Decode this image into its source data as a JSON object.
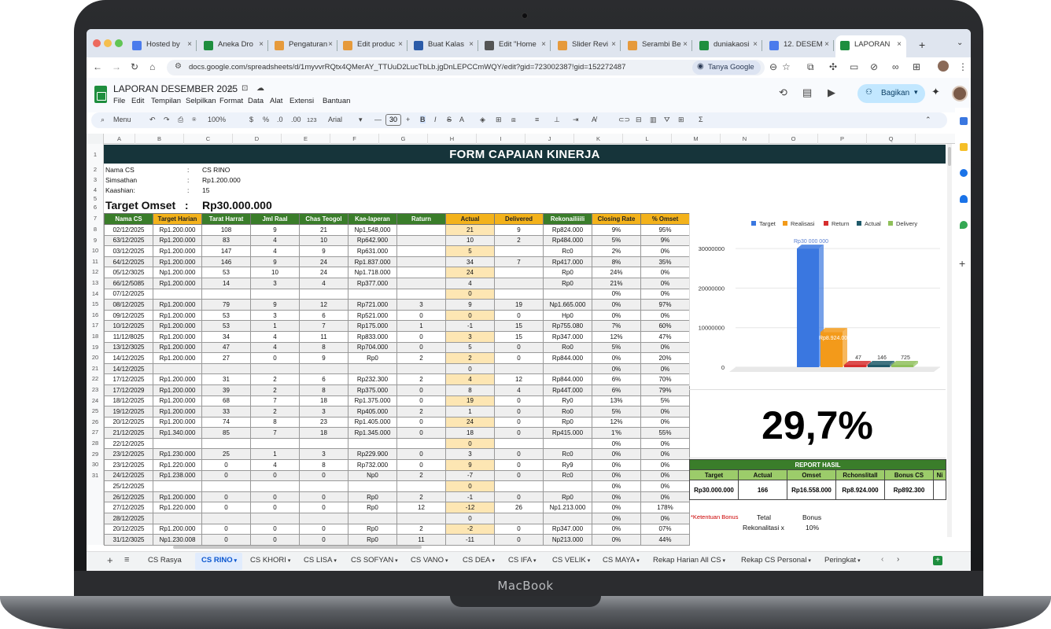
{
  "browser": {
    "tabs": [
      {
        "label": "Hosted by",
        "color": "#4b7bec"
      },
      {
        "label": "Aneka Dro",
        "color": "#1e8e3e"
      },
      {
        "label": "Pengaturan",
        "color": "#e69a3b"
      },
      {
        "label": "Edit produc",
        "color": "#e69a3b"
      },
      {
        "label": "Buat Kalas",
        "color": "#2b5ba8"
      },
      {
        "label": "Edit \"Home",
        "color": "#555"
      },
      {
        "label": "Slider Revi",
        "color": "#e69a3b"
      },
      {
        "label": "Serambi Be",
        "color": "#e69a3b"
      },
      {
        "label": "duniakaosi",
        "color": "#1e8e3e"
      },
      {
        "label": "12. DESEM",
        "color": "#4b7bec"
      },
      {
        "label": "LAPORAN",
        "color": "#1e8e3e"
      }
    ],
    "url": "docs.google.com/spreadsheets/d/1myvvrRQtx4QMerAY_TTUuD2LucTbLb.jgDnLEPCCmWQY/edit?gid=723002387!gid=152272487",
    "tanya": "Tanya Google"
  },
  "sheets": {
    "title": "LAPORAN DESEMBER 2025",
    "menus": [
      "File",
      "Edit",
      "Tempilan",
      "Selpilkan",
      "Format",
      "Data",
      "Alat",
      "Extensi",
      "Bantuan"
    ],
    "share": "Bagikan",
    "toolbar": {
      "menu": "Menu",
      "zoom": "100%",
      "currency": "$",
      "percent": "%",
      "fmt123": "123",
      "font": "Arial",
      "fontsize": "30",
      "minus": "—",
      "plus": "+",
      "bold": "B",
      "italic": "I",
      "strike": "S",
      "sigma": "Σ"
    }
  },
  "columns": [
    "A",
    "B",
    "C",
    "D",
    "E",
    "F",
    "G",
    "H",
    "I",
    "J",
    "K",
    "L",
    "M",
    "N",
    "O",
    "P",
    "Q"
  ],
  "rows": [
    "1",
    "2",
    "3",
    "4",
    "5",
    "6",
    "7",
    "8",
    "9",
    "10",
    "11",
    "12",
    "13",
    "14",
    "15",
    "16",
    "17",
    "18",
    "19",
    "20",
    "21",
    "22",
    "23",
    "24",
    "25",
    "26",
    "27",
    "28",
    "29",
    "30",
    "31"
  ],
  "form": {
    "title": "FORM CAPAIAN KINERJA",
    "info": [
      {
        "label": "Nama CS",
        "sep": ":",
        "value": "CS RINO"
      },
      {
        "label": "Simsathan",
        "sep": ":",
        "value": "Rp1.200.000"
      },
      {
        "label": "Kaashian:",
        "sep": ":",
        "value": "15"
      }
    ],
    "target_label": "Target Omset",
    "target_sep": ":",
    "target_value": "Rp30.000.000"
  },
  "table": {
    "headers": [
      "Nama CS",
      "Target Harian",
      "Tarat Harrat",
      "Jml Raal",
      "Chas Teogol",
      "Kae-laperan",
      "Raturn",
      "Actual",
      "Delivered",
      "Rekonailiiili",
      "Closing Rate",
      "% Omset"
    ],
    "rows": [
      [
        "02/12/2025",
        "Rp1.200.000",
        "108",
        "9",
        "21",
        "Np1,548,000",
        "",
        "21",
        "9",
        "Rp824.000",
        "9%",
        "95%"
      ],
      [
        "63/12/2025",
        "Rp1.200.000",
        "83",
        "4",
        "10",
        "Rp642.900",
        "",
        "10",
        "2",
        "Rp484.000",
        "5%",
        "9%"
      ],
      [
        "03/12/2025",
        "Rp1.200.000",
        "147",
        "4",
        "9",
        "Rp631.000",
        "",
        "5",
        "",
        "Rc0",
        "2%",
        "0%"
      ],
      [
        "64/12/2025",
        "Rp1.200.000",
        "146",
        "9",
        "24",
        "Rp1.837.000",
        "",
        "34",
        "7",
        "Rp417.000",
        "8%",
        "35%"
      ],
      [
        "05/12/3025",
        "Np1.200.000",
        "53",
        "10",
        "24",
        "Np1.718.000",
        "",
        "24",
        "",
        "Rp0",
        "24%",
        "0%"
      ],
      [
        "66/12/5085",
        "Rp1.200.000",
        "14",
        "3",
        "4",
        "Rp377.000",
        "",
        "4",
        "",
        "Rp0",
        "21%",
        "0%"
      ],
      [
        "07/12/2025",
        "",
        "",
        "",
        "",
        "",
        "",
        "0",
        "",
        "",
        "0%",
        "0%"
      ],
      [
        "08/12/2025",
        "Rp1.200.000",
        "79",
        "9",
        "12",
        "Rp721.000",
        "3",
        "9",
        "19",
        "Np1.665.000",
        "0%",
        "97%"
      ],
      [
        "09/12/2025",
        "Rp1.200.000",
        "53",
        "3",
        "6",
        "Rp521.000",
        "0",
        "0",
        "0",
        "Hp0",
        "0%",
        "0%"
      ],
      [
        "10/12/2025",
        "Rp1.200.000",
        "53",
        "1",
        "7",
        "Rp175.000",
        "1",
        "-1",
        "15",
        "Rp755.080",
        "7%",
        "60%"
      ],
      [
        "11/12/8025",
        "Rp1.200.000",
        "34",
        "4",
        "11",
        "Rp833.000",
        "0",
        "3",
        "15",
        "Rp347.000",
        "12%",
        "47%"
      ],
      [
        "13/12/3025",
        "Rp1.200.000",
        "47",
        "4",
        "8",
        "Rp704.000",
        "0",
        "5",
        "0",
        "Ro0",
        "5%",
        "0%"
      ],
      [
        "14/12/2025",
        "Rp1.200.000",
        "27",
        "0",
        "9",
        "Rp0",
        "2",
        "2",
        "0",
        "Rp844.000",
        "0%",
        "20%"
      ],
      [
        "14/12/2025",
        "",
        "",
        "",
        "",
        "",
        "",
        "0",
        "",
        "",
        "0%",
        "0%"
      ],
      [
        "17/12/2025",
        "Rp1.200.000",
        "31",
        "2",
        "6",
        "Rp232.300",
        "2",
        "4",
        "12",
        "Rp844.000",
        "6%",
        "70%"
      ],
      [
        "17/12/2029",
        "Rp1.200.000",
        "39",
        "2",
        "8",
        "Rp375.000",
        "0",
        "8",
        "4",
        "Rp44T.000",
        "6%",
        "79%"
      ],
      [
        "18/12/2025",
        "Rp1.200.000",
        "68",
        "7",
        "18",
        "Rp1.375.000",
        "0",
        "19",
        "0",
        "Ry0",
        "13%",
        "5%"
      ],
      [
        "19/12/2025",
        "Rp1.200.000",
        "33",
        "2",
        "3",
        "Rp405.000",
        "2",
        "1",
        "0",
        "Ro0",
        "5%",
        "0%"
      ],
      [
        "20/12/2025",
        "Rp1.200.000",
        "74",
        "8",
        "23",
        "Rp1.405.000",
        "0",
        "24",
        "0",
        "Rp0",
        "12%",
        "0%"
      ],
      [
        "21/12/2025",
        "Rp1.340.000",
        "85",
        "7",
        "18",
        "Rp1.345.000",
        "0",
        "18",
        "0",
        "Rp415.000",
        "1'%",
        "55%"
      ],
      [
        "22/12/2025",
        "",
        "",
        "",
        "",
        "",
        "",
        "0",
        "",
        "",
        "0%",
        "0%"
      ],
      [
        "23/12/2025",
        "Rp1.230.000",
        "25",
        "1",
        "3",
        "Rp229.900",
        "0",
        "3",
        "0",
        "Rc0",
        "0%",
        "0%"
      ],
      [
        "23/12/2025",
        "Rp1.220.000",
        "0",
        "4",
        "8",
        "Rp732.000",
        "0",
        "9",
        "0",
        "Ry9",
        "0%",
        "0%"
      ],
      [
        "24/12/2025",
        "Rp1.238.000",
        "0",
        "0",
        "0",
        "Np0",
        "2",
        "-7",
        "0",
        "Rc0",
        "0%",
        "0%"
      ],
      [
        "25/12/2025",
        "",
        "",
        "",
        "",
        "",
        "",
        "0",
        "",
        "",
        "0%",
        "0%"
      ],
      [
        "26/12/2025",
        "Rp1.200.000",
        "0",
        "0",
        "0",
        "Rp0",
        "2",
        "-1",
        "0",
        "Rp0",
        "0%",
        "0%"
      ],
      [
        "27/12/2025",
        "Rp1.220.000",
        "0",
        "0",
        "0",
        "Rp0",
        "12",
        "-12",
        "26",
        "Np1.213.000",
        "0%",
        "178%"
      ],
      [
        "28/12/2025",
        "",
        "",
        "",
        "",
        "",
        "",
        "0",
        "",
        "",
        "0%",
        "0%"
      ],
      [
        "20/12/2025",
        "Rp1.200.000",
        "0",
        "0",
        "0",
        "Rp0",
        "2",
        "-2",
        "0",
        "Rp347.000",
        "0%",
        "07%"
      ],
      [
        "31/12/3025",
        "Np1.230.008",
        "0",
        "0",
        "0",
        "Rp0",
        "11",
        "-11",
        "0",
        "Np213.000",
        "0%",
        "44%"
      ]
    ]
  },
  "chart_data": {
    "type": "bar",
    "legend_position": "top",
    "series": [
      {
        "name": "Target",
        "color": "#3a77e0"
      },
      {
        "name": "Realisasi",
        "color": "#f39a1a"
      },
      {
        "name": "Return",
        "color": "#d62e2e"
      },
      {
        "name": "Actual",
        "color": "#1f5a6a"
      },
      {
        "name": "Delivery",
        "color": "#8fc05a"
      }
    ],
    "values": [
      30000000,
      8924000,
      47,
      146,
      725
    ],
    "data_labels": [
      "Rp30 000 000",
      "Rp8.924.000",
      "47",
      "146",
      "725"
    ],
    "y_ticks": [
      "0",
      "10000000",
      "20000000",
      "30000000"
    ],
    "ylim": [
      0,
      33000000
    ]
  },
  "percentage": "29,7%",
  "report": {
    "title": "REPORT HASIL",
    "headers": [
      "Target",
      "Actual",
      "Omset",
      "Rchonslitall",
      "Bonus CS",
      "Ni"
    ],
    "values": [
      "Rp30.000.000",
      "166",
      "Rp16.558.000",
      "Rp8.924.000",
      "Rp892.300",
      ""
    ]
  },
  "bonus": {
    "label": "*Ketentuan Bonus",
    "col1": "Tetal",
    "col2": "Bonus",
    "row_label": "Rekonalitasi x",
    "row_value": "10%"
  },
  "sheet_tabs": [
    "CS Rasya",
    "CS RINO",
    "CS KHORI",
    "CS LISA",
    "CS SOFYAN",
    "CS VANO",
    "CS DEA",
    "CS IFA",
    "CS VELIK",
    "CS MAYA",
    "Rekap Harian All CS",
    "Rekap CS Personal",
    "Peringkat"
  ],
  "device_label": "MacBook"
}
